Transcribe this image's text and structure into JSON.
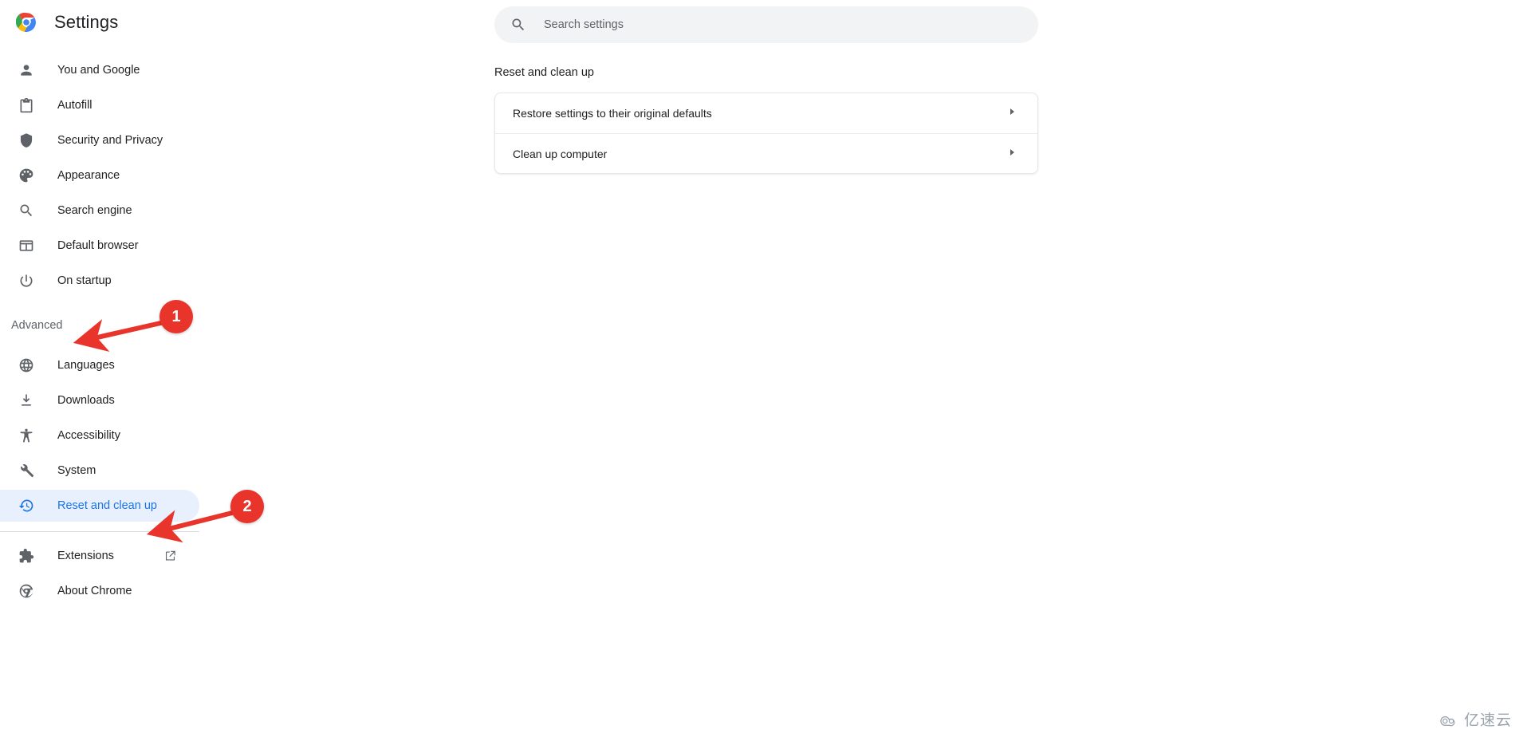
{
  "header": {
    "title": "Settings",
    "logo_icon": "chrome-logo-icon"
  },
  "search": {
    "placeholder": "Search settings",
    "value": "",
    "icon": "search-icon"
  },
  "sidebar": {
    "items": [
      {
        "label": "You and Google",
        "icon": "person-icon",
        "selected": false
      },
      {
        "label": "Autofill",
        "icon": "clipboard-icon",
        "selected": false
      },
      {
        "label": "Security and Privacy",
        "icon": "shield-icon",
        "selected": false
      },
      {
        "label": "Appearance",
        "icon": "palette-icon",
        "selected": false
      },
      {
        "label": "Search engine",
        "icon": "search-icon",
        "selected": false
      },
      {
        "label": "Default browser",
        "icon": "browser-window-icon",
        "selected": false
      },
      {
        "label": "On startup",
        "icon": "power-icon",
        "selected": false
      }
    ],
    "advanced": {
      "label": "Advanced",
      "expanded": true,
      "chevron_icon": "chevron-up-icon"
    },
    "advanced_items": [
      {
        "label": "Languages",
        "icon": "globe-icon",
        "selected": false
      },
      {
        "label": "Downloads",
        "icon": "download-icon",
        "selected": false
      },
      {
        "label": "Accessibility",
        "icon": "accessibility-icon",
        "selected": false
      },
      {
        "label": "System",
        "icon": "wrench-icon",
        "selected": false
      },
      {
        "label": "Reset and clean up",
        "icon": "history-restore-icon",
        "selected": true
      }
    ],
    "footer_items": [
      {
        "label": "Extensions",
        "icon": "puzzle-icon",
        "external_icon": "open-in-new-icon"
      },
      {
        "label": "About Chrome",
        "icon": "chrome-outline-icon",
        "external_icon": ""
      }
    ]
  },
  "main": {
    "section_title": "Reset and clean up",
    "rows": [
      {
        "label": "Restore settings to their original defaults",
        "arrow_icon": "chevron-right-icon"
      },
      {
        "label": "Clean up computer",
        "arrow_icon": "chevron-right-icon"
      }
    ]
  },
  "annotations": [
    {
      "number": "1",
      "target": "Advanced"
    },
    {
      "number": "2",
      "target": "Reset and clean up"
    }
  ],
  "watermark": {
    "text": "亿速云",
    "icon": "cloud-icon"
  },
  "colors": {
    "accent_blue": "#1a73e8",
    "selected_bg": "#e8f0fe",
    "annotation_red": "#e8342a",
    "text_primary": "#202124",
    "text_secondary": "#5f6368",
    "search_bg": "#f1f3f4"
  }
}
